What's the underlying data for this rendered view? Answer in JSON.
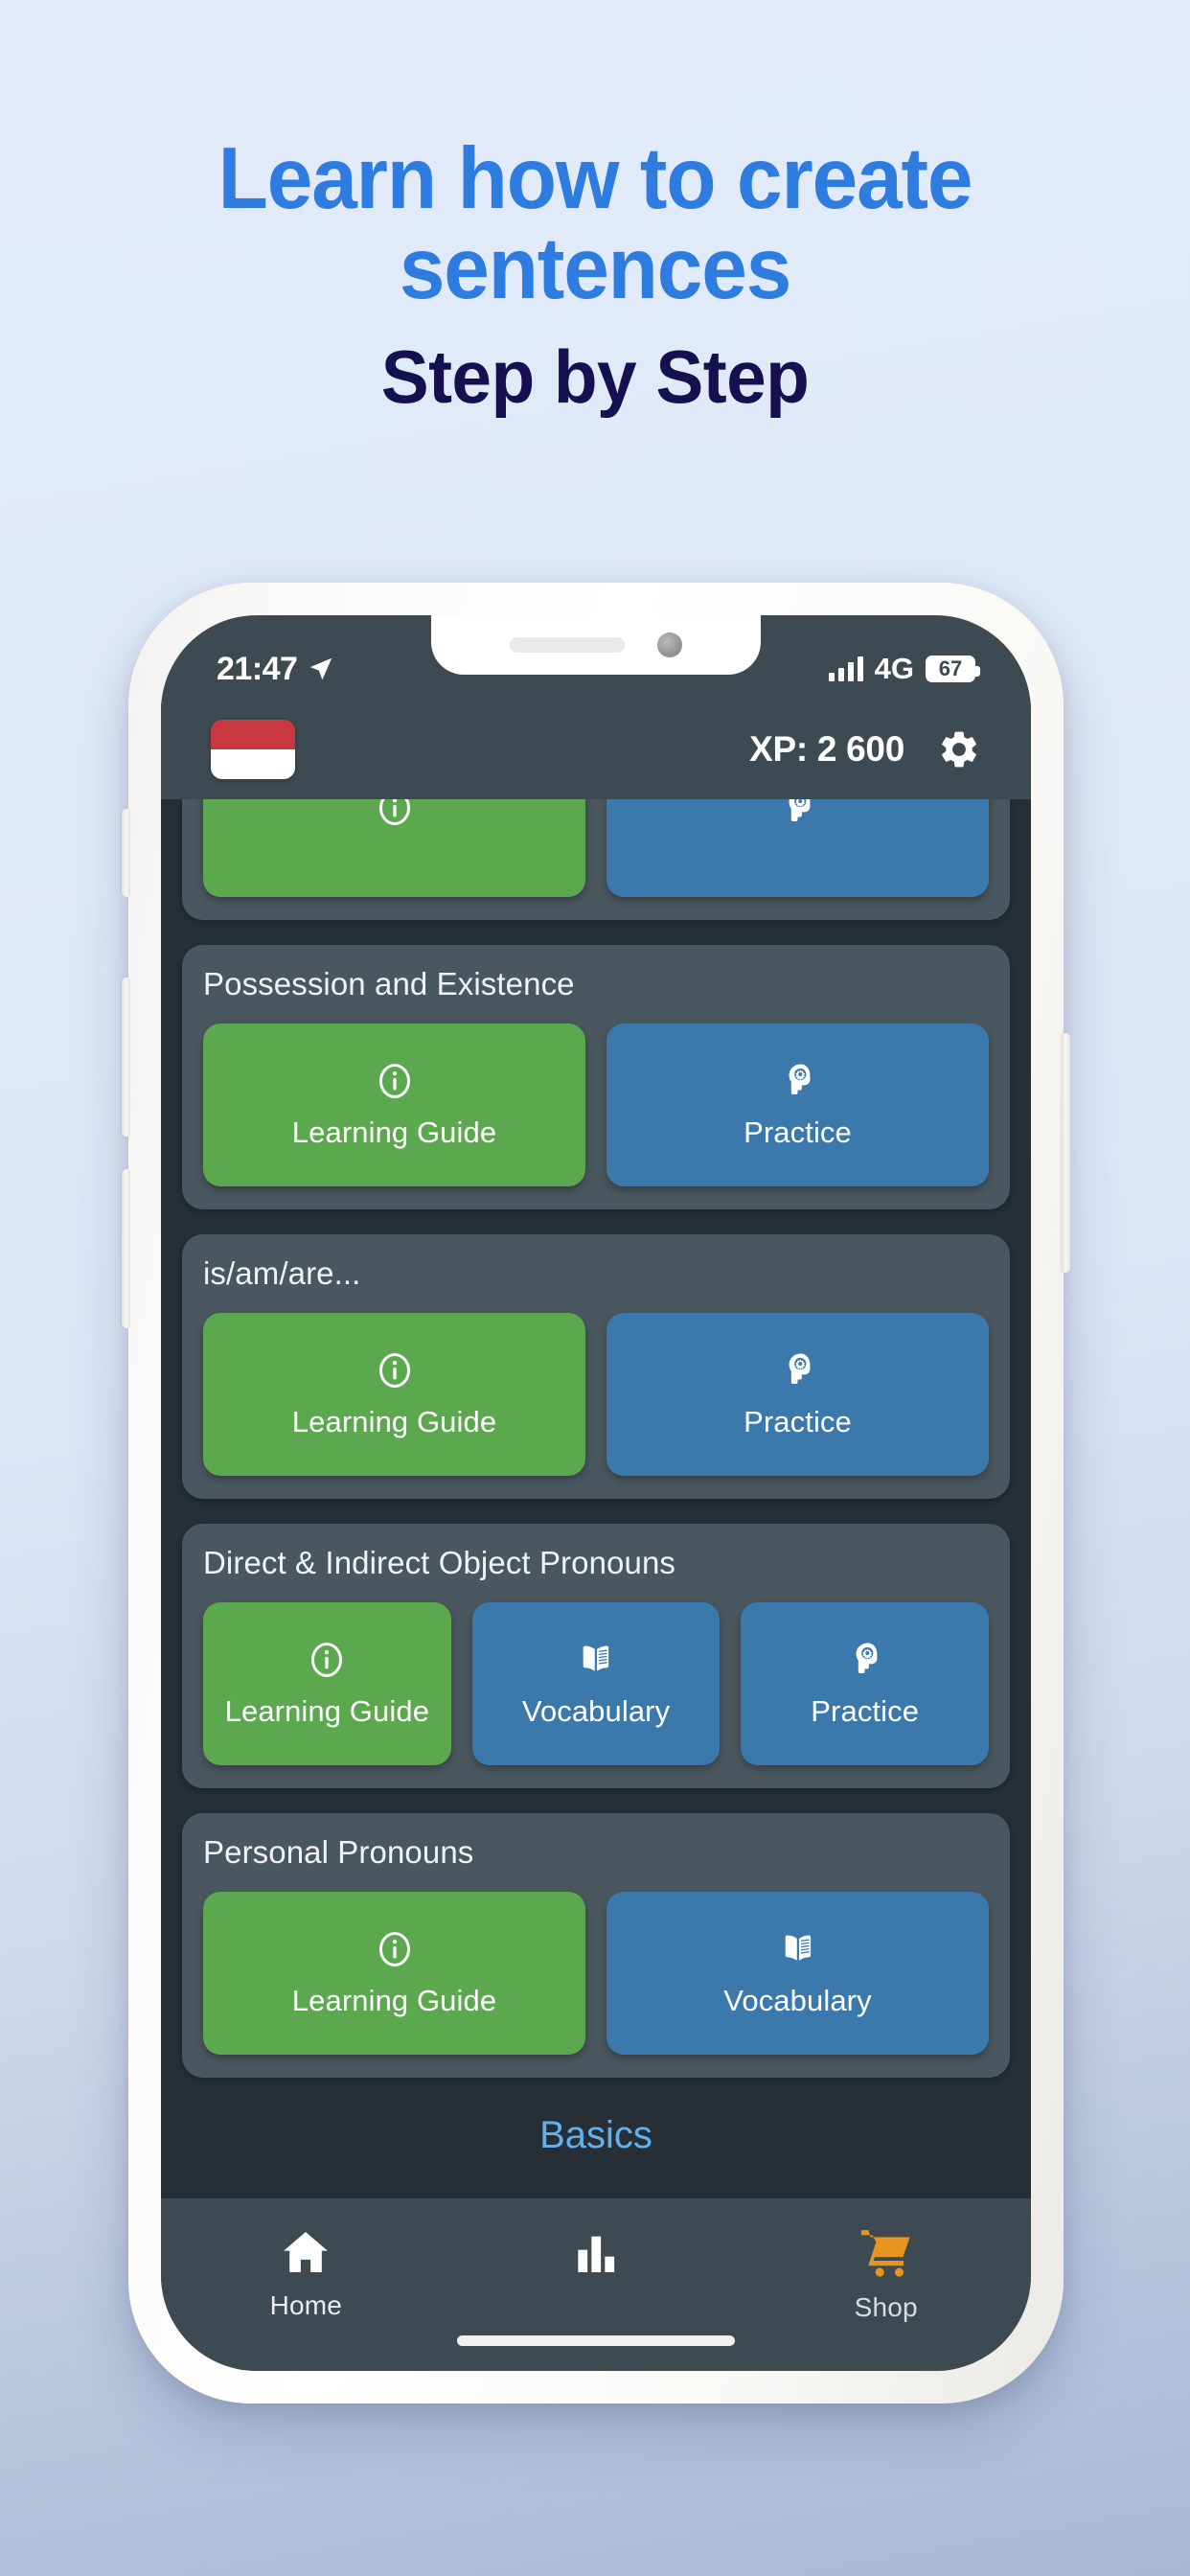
{
  "headline": {
    "line1": "Learn how to create",
    "line2": "sentences",
    "line3": "Step by Step",
    "blue_color": "#2f7ce0",
    "navy_color": "#171050"
  },
  "status_bar": {
    "clock": "21:47",
    "location_icon": "location-arrow-icon",
    "signal_icon": "signal-bars-icon",
    "network": "4G",
    "battery_percent": "67"
  },
  "app_header": {
    "flag_icon": "indonesia-flag-icon",
    "flag_top_color": "#c8393f",
    "flag_bottom_color": "#ffffff",
    "xp": "XP: 2 600",
    "settings_icon": "gear-icon"
  },
  "colors": {
    "screen_bg": "#262f36",
    "header_bg": "#3d4a52",
    "card_bg": "#4a575f",
    "green": "#5ba84e",
    "blue": "#3b78ab",
    "section_label": "#62b1ee",
    "shop_accent": "#e8951f"
  },
  "cards": [
    {
      "title": "",
      "clipped": true,
      "buttons": [
        {
          "label": "",
          "style": "green",
          "icon": "info-icon"
        },
        {
          "label": "",
          "style": "blue",
          "icon": "brain-gear-icon"
        }
      ]
    },
    {
      "title": "Possession and Existence",
      "clipped": false,
      "buttons": [
        {
          "label": "Learning Guide",
          "style": "green",
          "icon": "info-icon"
        },
        {
          "label": "Practice",
          "style": "blue",
          "icon": "brain-gear-icon"
        }
      ]
    },
    {
      "title": "is/am/are...",
      "clipped": false,
      "buttons": [
        {
          "label": "Learning Guide",
          "style": "green",
          "icon": "info-icon"
        },
        {
          "label": "Practice",
          "style": "blue",
          "icon": "brain-gear-icon"
        }
      ]
    },
    {
      "title": "Direct & Indirect Object Pronouns",
      "clipped": false,
      "buttons": [
        {
          "label": "Learning Guide",
          "style": "green",
          "icon": "info-icon"
        },
        {
          "label": "Vocabulary",
          "style": "blue",
          "icon": "book-icon"
        },
        {
          "label": "Practice",
          "style": "blue",
          "icon": "brain-gear-icon"
        }
      ]
    },
    {
      "title": "Personal Pronouns",
      "clipped": false,
      "buttons": [
        {
          "label": "Learning Guide",
          "style": "green",
          "icon": "info-icon"
        },
        {
          "label": "Vocabulary",
          "style": "blue",
          "icon": "book-icon"
        }
      ]
    }
  ],
  "section_label": "Basics",
  "bottom_nav": [
    {
      "label": "Home",
      "icon": "home-icon"
    },
    {
      "label": "",
      "icon": "bar-chart-icon"
    },
    {
      "label": "Shop",
      "icon": "shopping-cart-icon"
    }
  ]
}
